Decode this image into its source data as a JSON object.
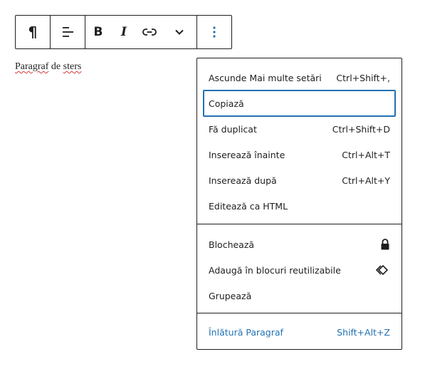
{
  "toolbar": {
    "buttons": [
      {
        "icon": "paragraph-icon",
        "glyph": "¶"
      },
      {
        "icon": "align-left-icon"
      },
      {
        "icon": "bold-icon",
        "glyph": "B"
      },
      {
        "icon": "italic-icon",
        "glyph": "I"
      },
      {
        "icon": "link-icon"
      },
      {
        "icon": "chevron-down-icon"
      },
      {
        "icon": "more-options-icon"
      }
    ]
  },
  "content": {
    "paragraph_word1": "Paragraf",
    "paragraph_word2": " de ",
    "paragraph_word3": "sters"
  },
  "menu": {
    "sections": [
      {
        "items": [
          {
            "label": "Ascunde Mai multe setări",
            "shortcut": "Ctrl+Shift+,"
          },
          {
            "label": "Copiază",
            "shortcut": "",
            "focused": true
          },
          {
            "label": "Fă duplicat",
            "shortcut": "Ctrl+Shift+D"
          },
          {
            "label": "Inserează înainte",
            "shortcut": "Ctrl+Alt+T"
          },
          {
            "label": "Inserează după",
            "shortcut": "Ctrl+Alt+Y"
          },
          {
            "label": "Editează ca HTML",
            "shortcut": ""
          }
        ]
      },
      {
        "items": [
          {
            "label": "Blochează",
            "icon": "lock-icon"
          },
          {
            "label": "Adaugă în blocuri reutilizabile",
            "icon": "reusable-block-icon"
          },
          {
            "label": "Grupează"
          }
        ]
      },
      {
        "items": [
          {
            "label": "Înlătură Paragraf",
            "shortcut": "Shift+Alt+Z",
            "danger": true
          }
        ]
      }
    ]
  },
  "colors": {
    "accent": "#2271b1",
    "text": "#1e1e1e",
    "border": "#1e1e1e",
    "spellcheck": "#d63638"
  }
}
